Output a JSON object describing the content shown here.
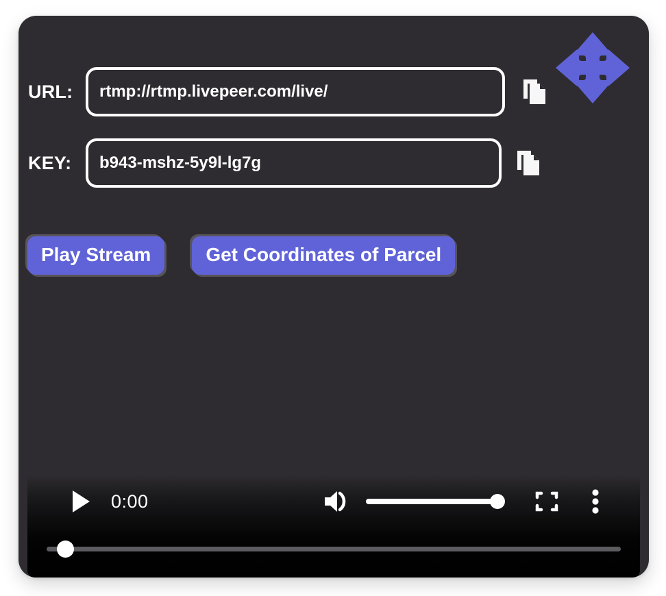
{
  "app": {
    "background_color": "#ffffff",
    "card_color": "#2e2c30",
    "accent_color": "#6063d8",
    "logo_icon": "four-way-arrows-icon"
  },
  "form": {
    "url": {
      "label": "URL:",
      "value": "rtmp://rtmp.livepeer.com/live/",
      "placeholder": "rtmp://rtmp.livepeer.com/live/",
      "copy_icon": "copy-icon"
    },
    "key": {
      "label": "KEY:",
      "value": "b943-mshz-5y9l-lg7g",
      "placeholder": "b943-mshz-5y9l-lg7g",
      "copy_icon": "copy-icon"
    }
  },
  "actions": {
    "play_stream_label": "Play Stream",
    "get_coordinates_label": "Get Coordinates of Parcel"
  },
  "player": {
    "current_time": "0:00",
    "play_icon": "play-icon",
    "volume_icon": "volume-high-icon",
    "fullscreen_icon": "fullscreen-icon",
    "more_icon": "more-vertical-icon",
    "volume_level": 100,
    "progress_percent": 0
  }
}
